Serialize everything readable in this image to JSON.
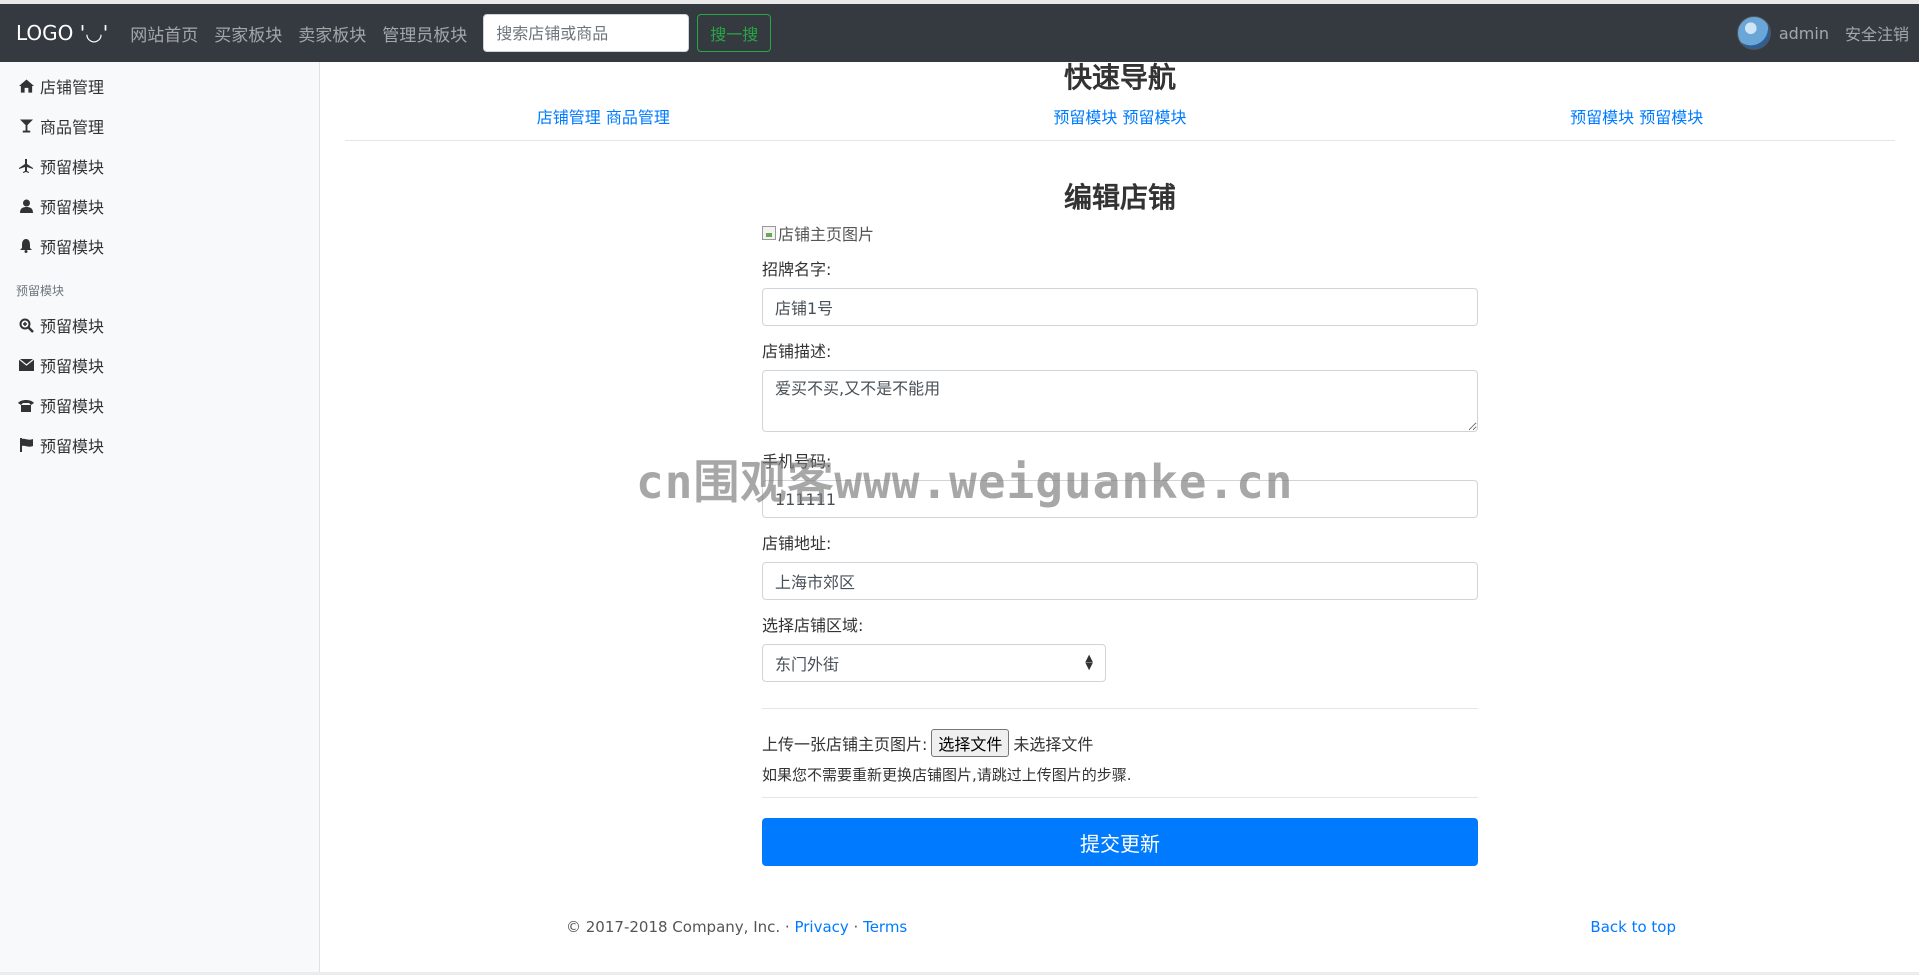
{
  "navbar": {
    "brand": "LOGO '◡'",
    "links": [
      "网站首页",
      "买家板块",
      "卖家板块",
      "管理员板块"
    ],
    "search_placeholder": "搜索店铺或商品",
    "search_button": "搜一搜",
    "user_name": "admin",
    "logout": "安全注销"
  },
  "sidebar": {
    "items": [
      {
        "label": "店铺管理",
        "icon": "home-icon"
      },
      {
        "label": "商品管理",
        "icon": "glass-icon"
      },
      {
        "label": "预留模块",
        "icon": "plane-icon"
      },
      {
        "label": "预留模块",
        "icon": "user-icon"
      },
      {
        "label": "预留模块",
        "icon": "bell-icon"
      }
    ],
    "section_heading": "预留模块",
    "section_items": [
      {
        "label": "预留模块",
        "icon": "zoom-icon"
      },
      {
        "label": "预留模块",
        "icon": "envelope-icon"
      },
      {
        "label": "预留模块",
        "icon": "phone-icon"
      },
      {
        "label": "预留模块",
        "icon": "flag-icon"
      }
    ]
  },
  "quick_nav": {
    "title": "快速导航",
    "groups": [
      [
        "店铺管理",
        "商品管理"
      ],
      [
        "预留模块",
        "预留模块"
      ],
      [
        "预留模块",
        "预留模块"
      ]
    ]
  },
  "form": {
    "title": "编辑店铺",
    "image_alt": "店铺主页图片",
    "name_label": "招牌名字:",
    "name_value": "店铺1号",
    "desc_label": "店铺描述:",
    "desc_value": "爱买不买,又不是不能用",
    "phone_label": "手机号码:",
    "phone_value": "111111",
    "address_label": "店铺地址:",
    "address_value": "上海市郊区",
    "region_label": "选择店铺区域:",
    "region_value": "东门外街",
    "upload_label": "上传一张店铺主页图片:",
    "file_button": "选择文件",
    "file_status": "未选择文件",
    "hint": "如果您不需要重新更换店铺图片,请跳过上传图片的步骤.",
    "submit": "提交更新"
  },
  "footer": {
    "copyright": "© 2017-2018 Company, Inc. · ",
    "privacy": "Privacy",
    "separator": " · ",
    "terms": "Terms",
    "back_to_top": "Back to top"
  },
  "watermark": "cn围观客www.weiguanke.cn",
  "colors": {
    "navbar_bg": "#343a40",
    "primary": "#007bff",
    "success": "#28a745",
    "sidebar_bg": "#f8f9fa"
  }
}
